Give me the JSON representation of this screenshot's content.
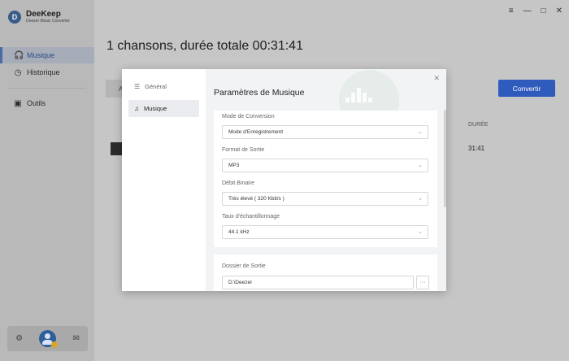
{
  "app": {
    "name": "DeeKeep",
    "subtitle": "Deezer Music Converter",
    "logo_letter": "D"
  },
  "sidebar": {
    "items": [
      {
        "label": "Musique",
        "icon": "headphones-icon"
      },
      {
        "label": "Historique",
        "icon": "clock-icon"
      },
      {
        "label": "Outils",
        "icon": "toolbox-icon"
      }
    ],
    "bottom": {
      "settings_icon": "gear-icon",
      "mail_icon": "mail-icon"
    }
  },
  "main": {
    "title": "1 chansons, durée totale 00:31:41",
    "convert_label": "Convertir",
    "list_header_partial": "A",
    "duration_header": "DURÉE",
    "row_duration": "31:41"
  },
  "modal": {
    "tabs": [
      {
        "label": "Général",
        "icon": "sliders-icon"
      },
      {
        "label": "Musique",
        "icon": "music-note-icon"
      }
    ],
    "title": "Paramètres de Musique",
    "fields": {
      "conversion_mode": {
        "label": "Mode de Conversion",
        "value": "Mode d'Enregistrement"
      },
      "output_format": {
        "label": "Format de Sortie",
        "value": "MP3"
      },
      "bitrate": {
        "label": "Débit Binaire",
        "value": "Très élevé ( 320 Kbit/s )"
      },
      "sample_rate": {
        "label": "Taux d'échantillonnage",
        "value": "44.1 kHz"
      },
      "output_folder": {
        "label": "Dossier de Sortie",
        "value": "D:\\Deezer",
        "browse_label": "···"
      }
    }
  },
  "colors": {
    "accent": "#2f5bbd",
    "overlay": "#c6c6c6"
  }
}
